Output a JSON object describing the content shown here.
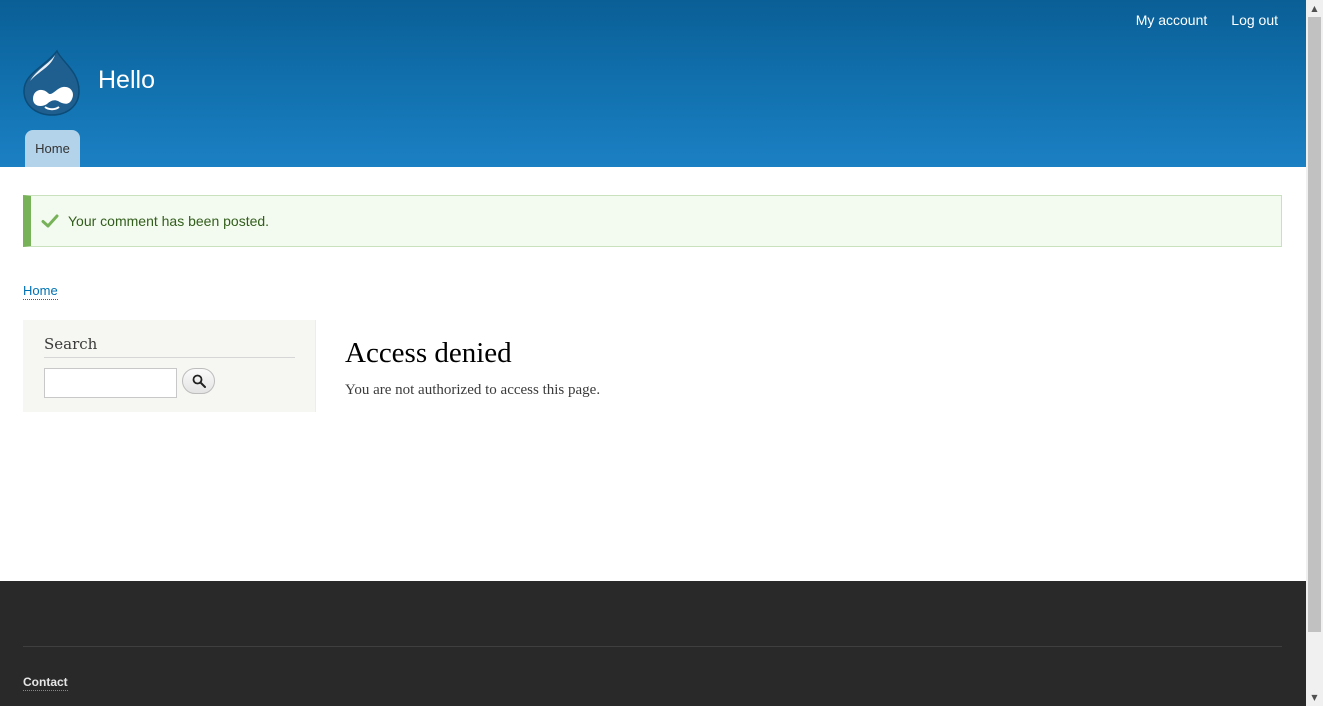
{
  "header": {
    "site_name": "Hello",
    "secondary_menu": [
      {
        "label": "My account"
      },
      {
        "label": "Log out"
      }
    ],
    "primary_tabs": [
      {
        "label": "Home",
        "active": true
      }
    ]
  },
  "status": {
    "message": "Your comment has been posted.",
    "color": "#77b259"
  },
  "breadcrumb": {
    "items": [
      {
        "label": "Home"
      }
    ]
  },
  "sidebar": {
    "search": {
      "title": "Search",
      "input_value": "",
      "button_icon": "magnifier-icon"
    }
  },
  "main": {
    "title": "Access denied",
    "body": "You are not authorized to access this page."
  },
  "footer": {
    "links": [
      {
        "label": "Contact"
      }
    ]
  },
  "colors": {
    "header_top": "#0a5f96",
    "header_bottom": "#1b80c3",
    "link": "#0071b3",
    "footer_bg": "#292929"
  }
}
